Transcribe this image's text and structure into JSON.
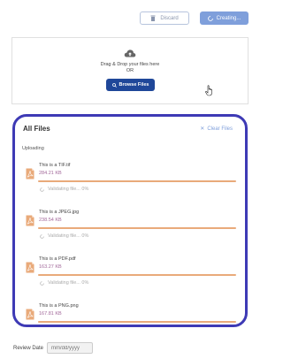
{
  "header": {
    "discard_label": "Discard",
    "creating_label": "Creating..."
  },
  "dropzone": {
    "title": "Drag & Drop your files here",
    "or_label": "OR",
    "browse_label": "Browse Files"
  },
  "files": {
    "title": "All Files",
    "clear_label": "Clear Files",
    "status_heading": "Uploading",
    "items": [
      {
        "name": "This is a TIF.tif",
        "size": "284.21 KB",
        "status": "Validating file... 0%",
        "progress": 1.0,
        "icon": "file-pdf-icon"
      },
      {
        "name": "This is a JPEG.jpg",
        "size": "238.54 KB",
        "status": "Validating file... 0%",
        "progress": 1.0,
        "icon": "file-pdf-icon"
      },
      {
        "name": "This is a PDF.pdf",
        "size": "163.27 KB",
        "status": "Validating file... 0%",
        "progress": 1.0,
        "icon": "file-pdf-icon"
      },
      {
        "name": "This is a PNG.png",
        "size": "167.81 KB",
        "status": "Validating file... 0%",
        "progress": 1.0,
        "icon": "file-pdf-icon"
      }
    ]
  },
  "review": {
    "label": "Review Date",
    "placeholder": "mm/dd/yyyy"
  },
  "colors": {
    "accent": "#3e3ab5",
    "primary_button": "#1f4799",
    "progress": "#e9aa7a",
    "file_icon": "#e9aa7a"
  }
}
